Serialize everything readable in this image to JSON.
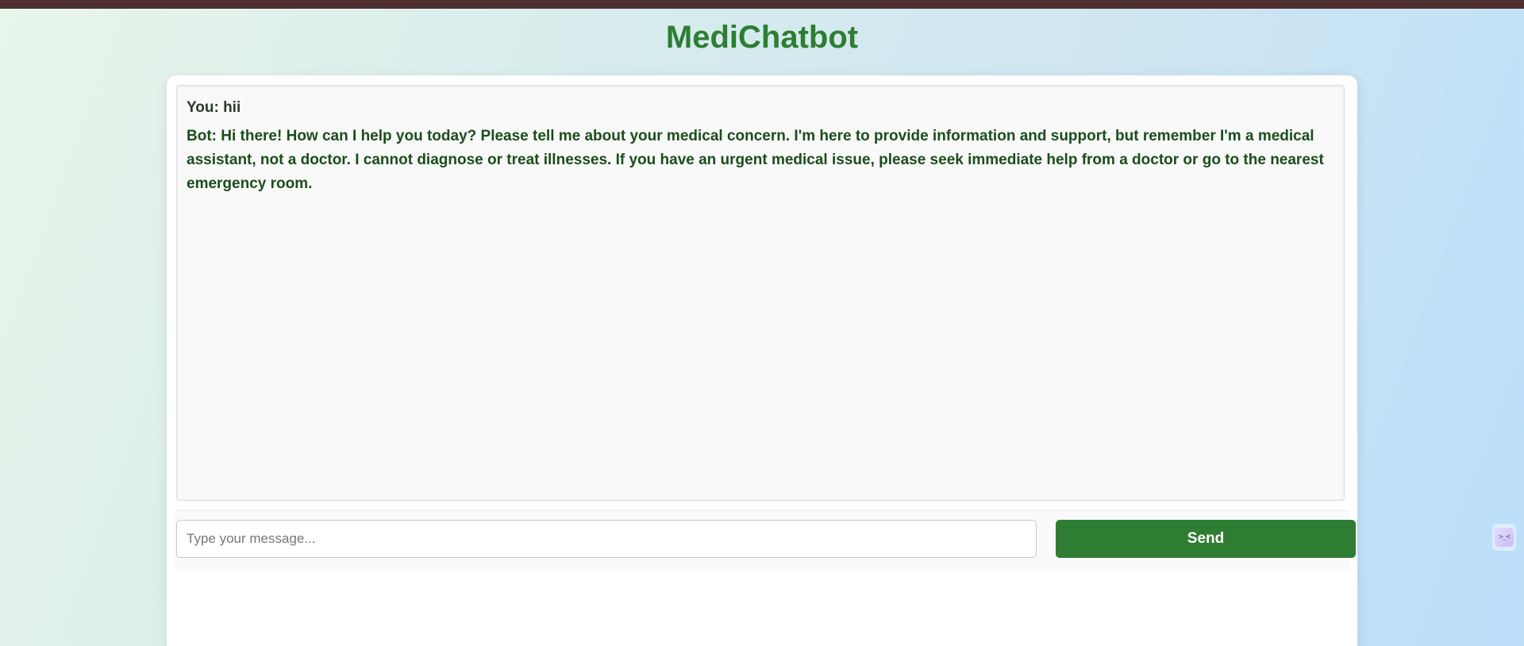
{
  "app": {
    "title": "MediChatbot"
  },
  "chat": {
    "messages": [
      {
        "sender": "user",
        "text": "You: hii"
      },
      {
        "sender": "bot",
        "text": "Bot: Hi there! How can I help you today? Please tell me about your medical concern. I'm here to provide information and support, but remember I'm a medical assistant, not a doctor. I cannot diagnose or treat illnesses. If you have an urgent medical issue, please seek immediate help from a doctor or go to the nearest emergency room."
      }
    ]
  },
  "input": {
    "value": "",
    "placeholder": "Type your message..."
  },
  "send_button": {
    "label": "Send"
  },
  "side_widget": {
    "glyph": ">_<",
    "icon": "assistant-face-icon"
  },
  "colors": {
    "brand_green": "#2e7d32",
    "top_strip": "#4e3030",
    "bot_text": "#1b4d1b"
  }
}
